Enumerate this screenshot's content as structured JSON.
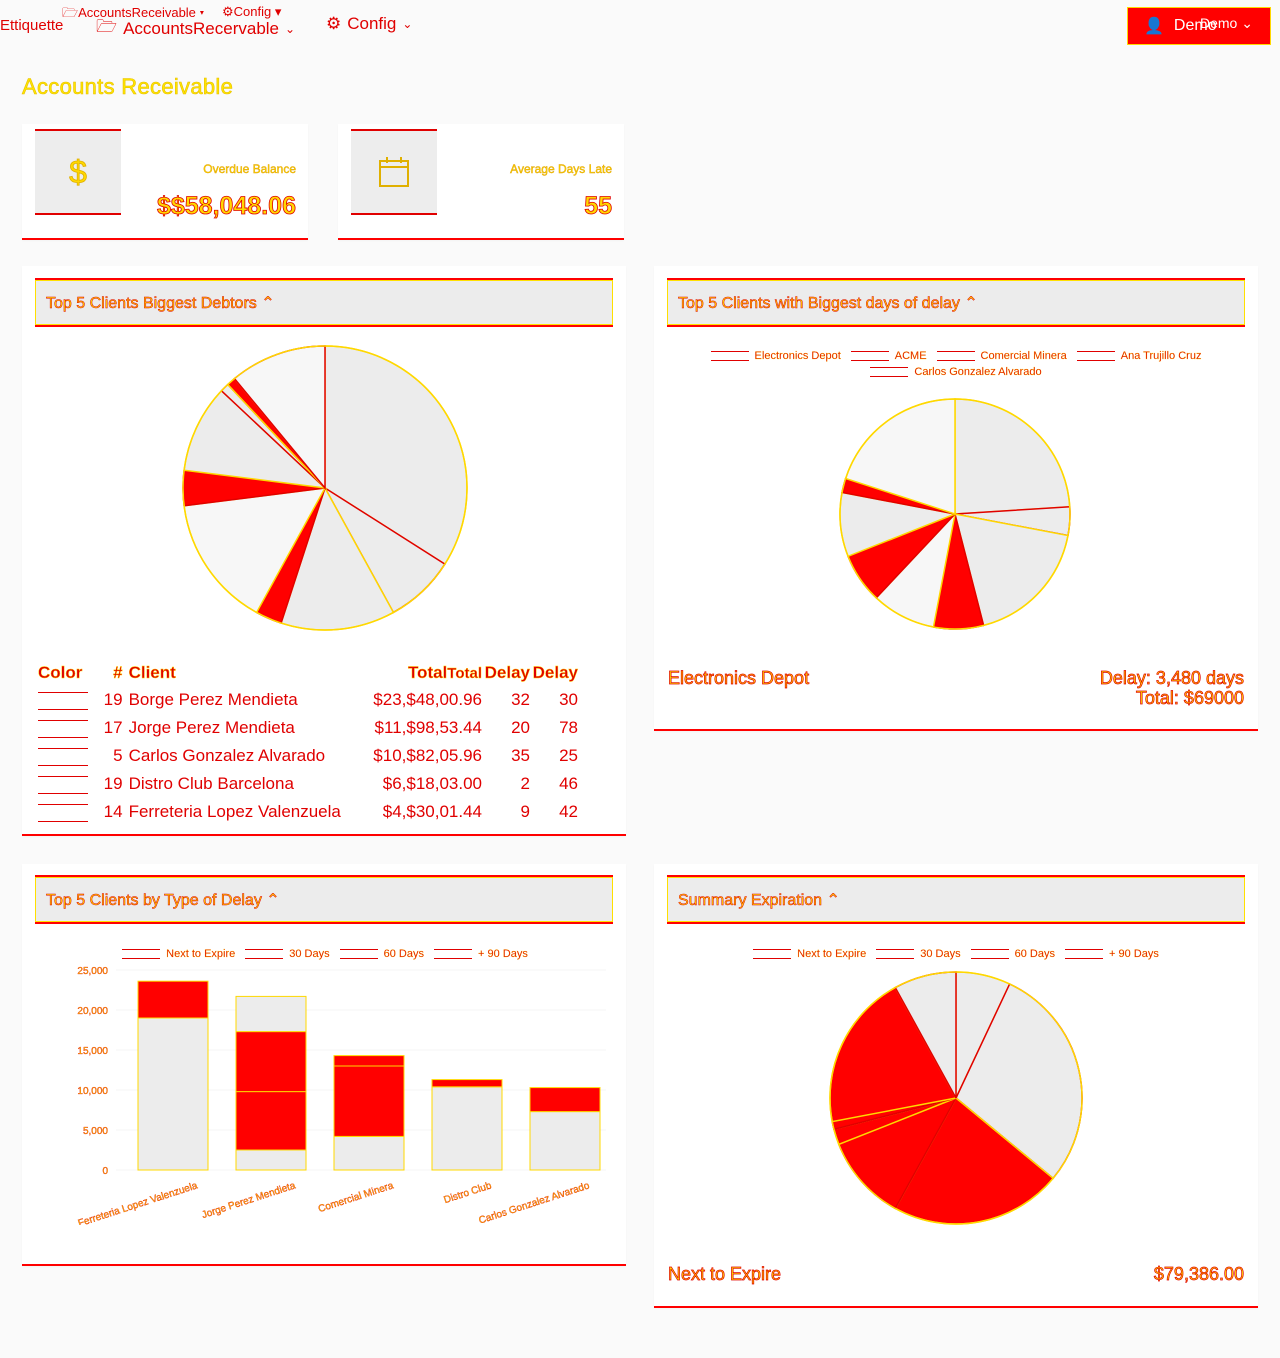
{
  "nav": {
    "brand": "Ettiquette",
    "accounts": "AccountsRecervable",
    "config": "Config",
    "ghost_accounts": "AccountsReceivable",
    "ghost_config": "Config",
    "user": "Demo",
    "user_dup": "Demo"
  },
  "page_title": "Accounts Receivable",
  "kpis": [
    {
      "label": "Overdue Balance",
      "value": "$$58,048.06",
      "icon": "dollar-icon"
    },
    {
      "label": "Average Days Late",
      "value": "55",
      "icon": "calendar-icon"
    }
  ],
  "panels": {
    "debtors": {
      "title": "Top 5 Clients Biggest Debtors"
    },
    "delay": {
      "title": "Top 5 Clients with Biggest days of delay"
    },
    "type_delay": {
      "title": "Top 5 Clients by Type of Delay"
    },
    "expiration": {
      "title": "Summary Expiration"
    }
  },
  "debtors_table": {
    "headers": {
      "color": "Color",
      "num": "#",
      "client": "Client",
      "total": "Total",
      "delay": "Delay",
      "total_ghost": "Total",
      "delay_ghost": "Delay"
    },
    "rows": [
      {
        "num": "19",
        "client": "Borge Perez Mendieta",
        "total": "$23,$48,00.96",
        "delay": "32",
        "delay2": "30"
      },
      {
        "num": "17",
        "client": "Jorge Perez Mendieta",
        "total": "$11,$98,53.44",
        "delay": "20",
        "delay2": "78"
      },
      {
        "num": "5",
        "client": "Carlos Gonzalez Alvarado",
        "total": "$10,$82,05.96",
        "delay": "35",
        "delay2": "25"
      },
      {
        "num": "19",
        "client": "Distro Club Barcelona",
        "total": "$6,$18,03.00",
        "delay": "2",
        "delay2": "46"
      },
      {
        "num": "14",
        "client": "Ferreteria Lopez Valenzuela",
        "total": "$4,$30,01.44",
        "delay": "9",
        "delay2": "42"
      }
    ]
  },
  "delay_legend": [
    "Electronics Depot",
    "ACME",
    "Comercial Minera",
    "Ana Trujillo Cruz",
    "Carlos Gonzalez Alvarado"
  ],
  "delay_footer": {
    "left": "Electronics Depot",
    "right1": "Delay: 3,480 days",
    "right2": "Total: $69000"
  },
  "type_legend": [
    "Next to Expire",
    "30 Days",
    "60 Days",
    "+ 90 Days"
  ],
  "expiration_footer": {
    "left": "Next to Expire",
    "right": "$79,386.00"
  },
  "colors": {
    "accent": "#ff0000",
    "outline": "#ffd800",
    "panel": "#ececec"
  },
  "chart_data": [
    {
      "type": "pie",
      "title": "Top 5 Clients Biggest Debtors",
      "slices": [
        {
          "value": 34,
          "color": "#ececec"
        },
        {
          "value": 8,
          "color": "#ececec"
        },
        {
          "value": 13,
          "color": "#ececec"
        },
        {
          "value": 3,
          "color": "#ff0000"
        },
        {
          "value": 15,
          "color": "#f7f7f7"
        },
        {
          "value": 4,
          "color": "#ff0000"
        },
        {
          "value": 10,
          "color": "#ececec"
        },
        {
          "value": 1,
          "color": "#ececec"
        },
        {
          "value": 1,
          "color": "#ff0000"
        },
        {
          "value": 11,
          "color": "#f7f7f7"
        }
      ]
    },
    {
      "type": "pie",
      "title": "Top 5 Clients with Biggest days of delay",
      "slices": [
        {
          "value": 24,
          "color": "#ececec"
        },
        {
          "value": 4,
          "color": "#ececec"
        },
        {
          "value": 18,
          "color": "#ececec"
        },
        {
          "value": 7,
          "color": "#ff0000"
        },
        {
          "value": 9,
          "color": "#f7f7f7"
        },
        {
          "value": 7,
          "color": "#ff0000"
        },
        {
          "value": 9,
          "color": "#ececec"
        },
        {
          "value": 2,
          "color": "#ff0000"
        },
        {
          "value": 20,
          "color": "#f7f7f7"
        }
      ]
    },
    {
      "type": "bar",
      "title": "Top 5 Clients by Type of Delay",
      "categories": [
        "Ferreteria Lopez Valenzuela",
        "Jorge Perez Mendieta",
        "Comercial Minera",
        "Distro Club",
        "Carlos Gonzalez Alvarado"
      ],
      "series": [
        {
          "name": "Next to Expire",
          "values": [
            19000,
            2500,
            4200,
            10400,
            7300
          ]
        },
        {
          "name": "30 Days",
          "values": [
            4600,
            7300,
            8800,
            900,
            3000
          ]
        },
        {
          "name": "60 Days",
          "values": [
            0,
            7500,
            1300,
            0,
            0
          ]
        },
        {
          "name": "+ 90 Days",
          "values": [
            0,
            4400,
            0,
            0,
            0
          ]
        }
      ],
      "yticks": [
        "25,000",
        "20,000",
        "15,000",
        "10,000",
        "5,000",
        "0"
      ],
      "ylim": [
        0,
        25000
      ]
    },
    {
      "type": "pie",
      "title": "Summary Expiration",
      "slices": [
        {
          "value": 7,
          "color": "#ececec"
        },
        {
          "value": 29,
          "color": "#ececec"
        },
        {
          "value": 22,
          "color": "#ff0000"
        },
        {
          "value": 11,
          "color": "#ff0000"
        },
        {
          "value": 2,
          "color": "#ff0000"
        },
        {
          "value": 1,
          "color": "#ff0000"
        },
        {
          "value": 20,
          "color": "#ff0000"
        },
        {
          "value": 8,
          "color": "#ececec"
        }
      ]
    }
  ]
}
